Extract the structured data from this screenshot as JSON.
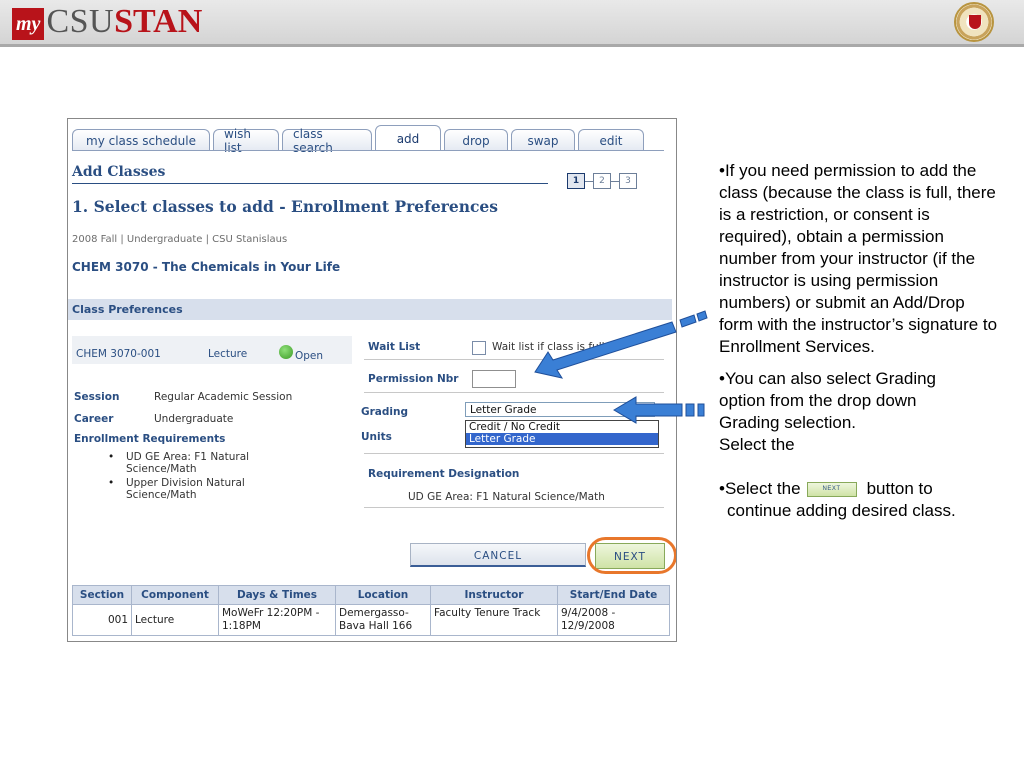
{
  "header": {
    "logo_my": "my",
    "logo_csu": "CSU",
    "logo_stan": "STAN"
  },
  "tabs": [
    "my class schedule",
    "wish list",
    "class search",
    "add",
    "drop",
    "swap",
    "edit"
  ],
  "page": {
    "title": "Add Classes",
    "steps": [
      "1",
      "2",
      "3"
    ],
    "heading": "1.  Select classes to add - Enrollment Preferences",
    "term_line": "2008 Fall | Undergraduate | CSU Stanislaus",
    "course_title": "CHEM 3070 - The Chemicals in Your Life"
  },
  "prefs": {
    "section_title": "Class Preferences",
    "class_code": "CHEM 3070-001",
    "component": "Lecture",
    "status": "Open",
    "session_label": "Session",
    "session_value": "Regular Academic Session",
    "career_label": "Career",
    "career_value": "Undergraduate",
    "enroll_req_label": "Enrollment Requirements",
    "requirements": [
      "UD GE Area: F1 Natural Science/Math",
      "Upper Division Natural Science/Math"
    ],
    "wait_list_label": "Wait List",
    "wait_list_checkbox": "Wait list if class is full",
    "wait_list_checked": false,
    "permission_label": "Permission Nbr",
    "permission_value": "",
    "grading_label": "Grading",
    "grading_selected": "Letter Grade",
    "grading_options": [
      "Credit / No Credit",
      "Letter Grade"
    ],
    "units_label": "Units",
    "req_designation_label": "Requirement Designation",
    "req_designation_value": "UD GE Area: F1 Natural Science/Math"
  },
  "buttons": {
    "cancel": "CANCEL",
    "next": "NEXT"
  },
  "schedule_table": {
    "columns": [
      "Section",
      "Component",
      "Days & Times",
      "Location",
      "Instructor",
      "Start/End Date"
    ],
    "rows": [
      [
        "001",
        "Lecture",
        "MoWeFr 12:20PM - 1:18PM",
        "Demergasso-Bava Hall 166",
        "Faculty Tenure Track",
        "9/4/2008 - 12/9/2008"
      ]
    ]
  },
  "notes": {
    "bullet1": "•If you need permission to add the class (because the class is full, there is a restriction, or consent is required), obtain a permission number from your instructor (if the instructor is using permission numbers) or submit an Add/Drop form with the instructor’s signature to Enrollment Services.",
    "bullet2_line1": "•You can also select Grading option from the drop down Grading selection.",
    "bullet2_line2": "Select the",
    "bullet3_pre": "•Select the",
    "bullet3_button": "NEXT",
    "bullet3_post": "button to continue adding desired class."
  },
  "colors": {
    "arrow": "#3a7fd5",
    "highlight_ring": "#e8772b",
    "brand_red": "#b8131a"
  }
}
